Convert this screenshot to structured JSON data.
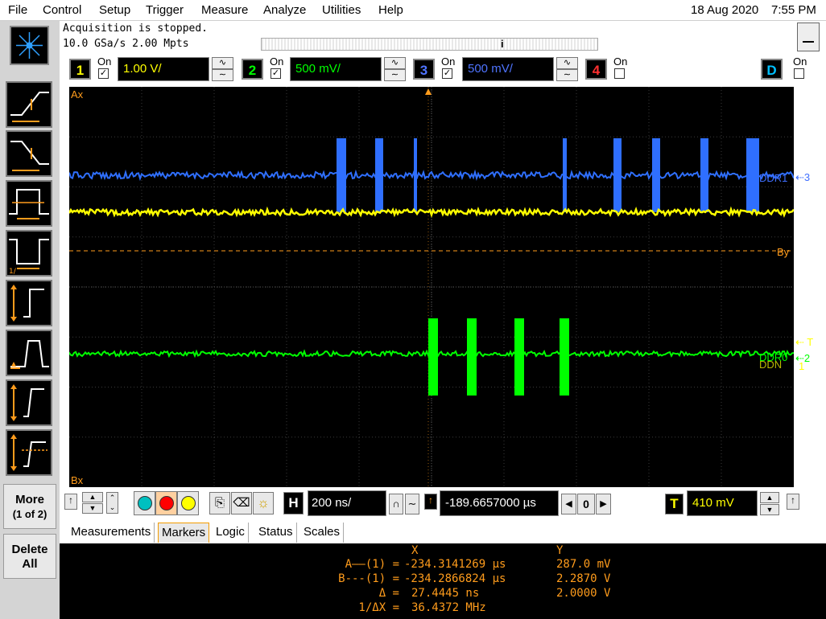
{
  "menu": {
    "items": [
      "File",
      "Control",
      "Setup",
      "Trigger",
      "Measure",
      "Analyze",
      "Utilities",
      "Help"
    ],
    "date": "18 Aug 2020",
    "time": "7:55 PM"
  },
  "status": {
    "line1": "Acquisition is stopped.",
    "line2": "10.0 GSa/s   2.00 Mpts"
  },
  "channels": [
    {
      "num": "1",
      "on_label": "On",
      "checked": true,
      "scale": "1.00 V/",
      "color": "#ffff00"
    },
    {
      "num": "2",
      "on_label": "On",
      "checked": true,
      "scale": "500 mV/",
      "color": "#00ff00"
    },
    {
      "num": "3",
      "on_label": "On",
      "checked": true,
      "scale": "500 mV/",
      "color": "#4f74ff"
    },
    {
      "num": "4",
      "on_label": "On",
      "checked": false,
      "color": "#ff3030"
    },
    {
      "num": "D",
      "on_label": "On",
      "checked": false,
      "color": "#00c0ff"
    }
  ],
  "screen": {
    "ax_label": "Ax",
    "bx_label": "Bx",
    "by_label": "By",
    "ddr1_label": "DDR1",
    "ddr0_label": "DDR0",
    "ddr0_shadow": "DDN",
    "trigger_marker": "T",
    "ref1": "1",
    "ref2": "2",
    "ref3": "3",
    "colors": {
      "ch1": "#ffff00",
      "ch2": "#00ff00",
      "ch3": "#2f6fff",
      "marker": "#ff9c1c",
      "grid": "#3a3a3a"
    }
  },
  "sidebar": {
    "more_label": "More",
    "more_sub": "(1 of 2)",
    "delete_label": "Delete",
    "delete_sub": "All"
  },
  "bottom": {
    "timebase": "200 ns/",
    "h_label": "H",
    "delay": "-189.6657000 µs",
    "delay_ref": "0",
    "trigger_label": "T",
    "trigger_level": "410 mV"
  },
  "tabs": [
    "Measurements",
    "Markers",
    "Logic",
    "Status",
    "Scales"
  ],
  "active_tab": "Markers",
  "markers": {
    "header_x": "X",
    "header_y": "Y",
    "rows": [
      {
        "label": "A——(1) =",
        "x": "-234.3141269 µs",
        "y": "287.0 mV"
      },
      {
        "label": "B---(1) =",
        "x": "-234.2866824 µs",
        "y": "2.2870 V"
      },
      {
        "label": "Δ =",
        "x": "27.4445 ns",
        "y": "2.0000 V"
      },
      {
        "label": "1/ΔX =",
        "x": "36.4372 MHz",
        "y": ""
      }
    ]
  },
  "icons": {
    "logo": "agilent-starburst-icon",
    "trig1": "rising-edge-trigger-icon",
    "trig2": "falling-edge-trigger-icon",
    "trig3": "pulse-width-trigger-icon",
    "trig4": "inverse-pulse-trigger-icon",
    "trig5": "setup-hold-trigger-icon",
    "trig6": "runt-trigger-icon",
    "trig7": "transition-trigger-icon",
    "trig8": "window-trigger-icon"
  }
}
